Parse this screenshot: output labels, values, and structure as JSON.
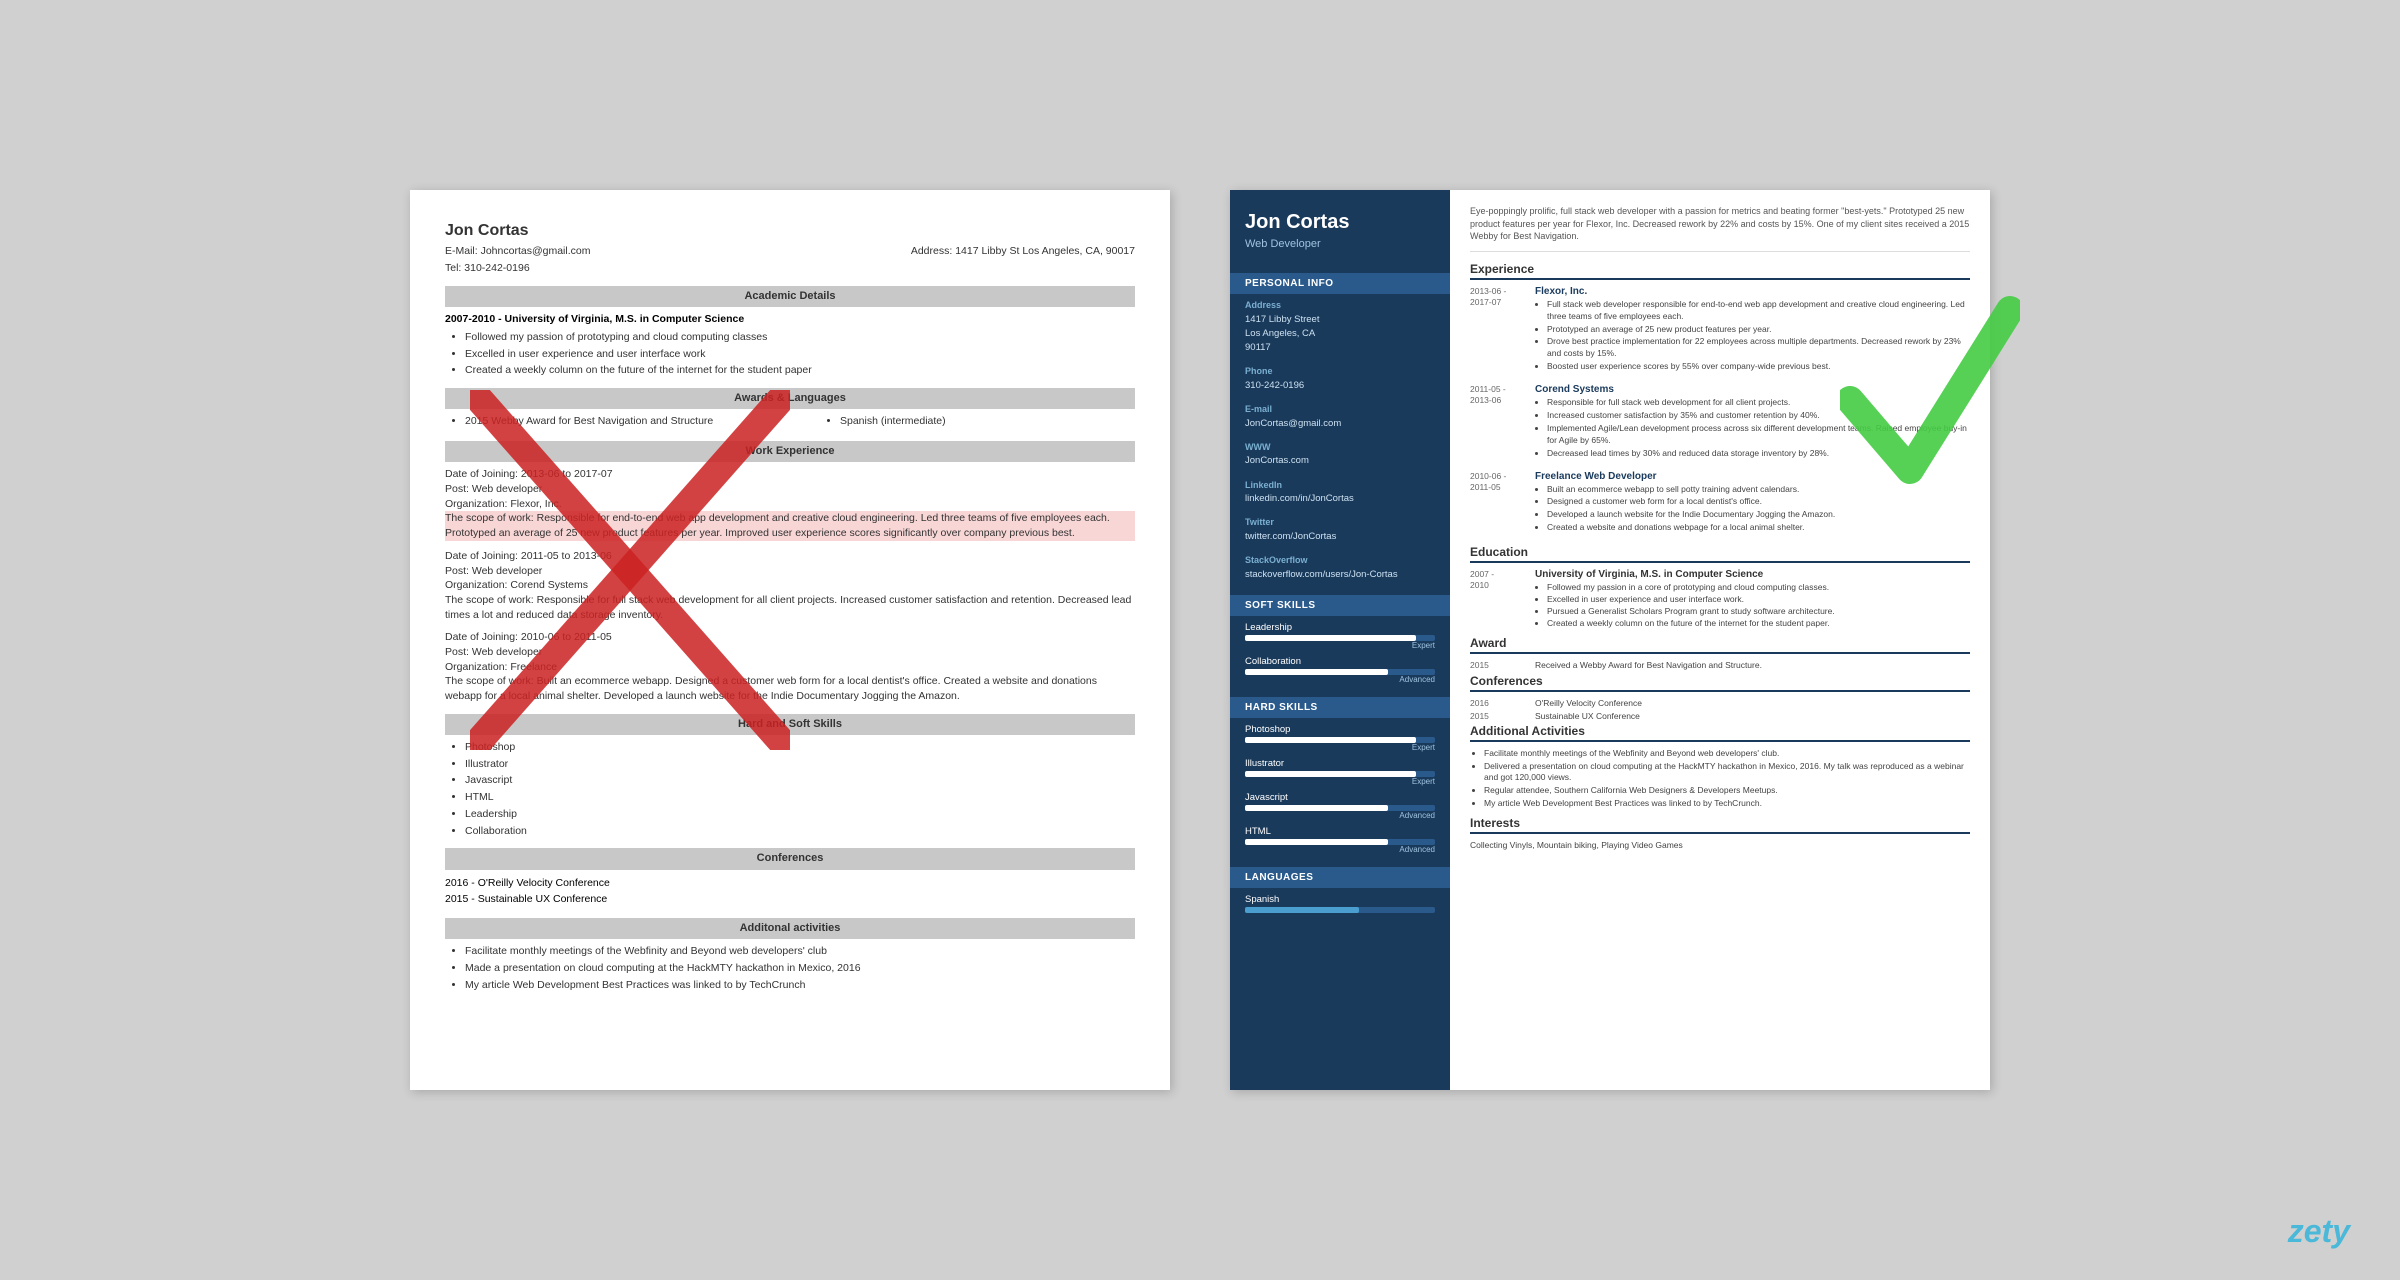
{
  "page": {
    "background": "#d0d0d0"
  },
  "brand": {
    "name": "zety"
  },
  "left_resume": {
    "name": "Jon Cortas",
    "email_label": "E-Mail:",
    "email": "Johncortas@gmail.com",
    "address_label": "Address:",
    "address": "1417 Libby St Los Angeles, CA, 90017",
    "tel_label": "Tel:",
    "tel": "310-242-0196",
    "sections": {
      "academic": "Academic Details",
      "awards": "Awards & Languages",
      "work": "Work Experience",
      "skills": "Hard and Soft Skills",
      "conferences": "Conferences",
      "activities": "Additonal activities"
    },
    "academic": {
      "date": "2007-2010 - University of Virginia, M.S. in Computer Science",
      "bullets": [
        "Followed my passion of prototyping and cloud computing classes",
        "Excelled in user experience and user interface work",
        "Created a weekly column on the future of the internet for the student paper"
      ]
    },
    "awards": {
      "item": "2015 Webby Award for Best Navigation and Structure",
      "language": "Spanish (intermediate)"
    },
    "work": [
      {
        "date": "Date of Joining: 2013-06 to 2017-07",
        "post": "Post: Web developer",
        "org": "Organization: Flexor, Inc.",
        "scope": "The scope of work: Responsible for end-to-end web app development and creative cloud engineering. Led three teams of five employees each. Prototyped an average of 25 new product features per year. Improved user experience scores significantly over company previous best."
      },
      {
        "date": "Date of Joining: 2011-05 to 2013-06",
        "post": "Post: Web developer",
        "org": "Organization: Corend Systems",
        "scope": "The scope of work: Responsible for full stack web development for all client projects. Increased customer satisfaction and retention. Decreased lead times a lot and reduced data storage inventory."
      },
      {
        "date": "Date of Joining: 2010-06 to 2011-05",
        "post": "Post: Web developer",
        "org": "Organization: Freelance",
        "scope": "The scope of work: Built an ecommerce webapp. Designed a customer web form for a local dentist's office. Created a website and donations webapp for a local animal shelter. Developed a launch website for the Indie Documentary Jogging the Amazon."
      }
    ],
    "skills": [
      "Photoshop",
      "Illustrator",
      "Javascript",
      "HTML",
      "Leadership",
      "Collaboration"
    ],
    "conferences": [
      "2016 - O'Reilly Velocity Conference",
      "2015 - Sustainable UX Conference"
    ],
    "activities": [
      "Facilitate monthly meetings of the Webfinity and Beyond web developers' club",
      "Made a presentation on cloud computing at the HackMTY hackathon in Mexico, 2016",
      "My article Web Development Best Practices was linked to by TechCrunch"
    ]
  },
  "right_resume": {
    "name": "Jon Cortas",
    "title": "Web Developer",
    "summary": "Eye-poppingly prolific, full stack web developer with a passion for metrics and beating former \"best-yets.\" Prototyped 25 new product features per year for Flexor, Inc. Decreased rework by 22% and costs by 15%. One of my client sites received a 2015 Webby for Best Navigation.",
    "sidebar": {
      "personal_info_label": "Personal Info",
      "address_label": "Address",
      "address": "1417 Libby Street\nLos Angeles, CA\n90117",
      "phone_label": "Phone",
      "phone": "310-242-0196",
      "email_label": "E-mail",
      "email": "JonCortas@gmail.com",
      "www_label": "WWW",
      "www": "JonCortas.com",
      "linkedin_label": "LinkedIn",
      "linkedin": "linkedin.com/in/JonCortas",
      "twitter_label": "Twitter",
      "twitter": "twitter.com/JonCortas",
      "stackoverflow_label": "StackOverflow",
      "stackoverflow": "stackoverflow.com/users/Jon-Cortas",
      "soft_skills_label": "Soft Skills",
      "soft_skills": [
        {
          "name": "Leadership",
          "level": "Expert",
          "pct": 90
        },
        {
          "name": "Collaboration",
          "level": "Advanced",
          "pct": 75
        }
      ],
      "hard_skills_label": "Hard Skills",
      "hard_skills": [
        {
          "name": "Photoshop",
          "level": "Expert",
          "pct": 90
        },
        {
          "name": "Illustrator",
          "level": "Expert",
          "pct": 90
        },
        {
          "name": "Javascript",
          "level": "Advanced",
          "pct": 75
        },
        {
          "name": "HTML",
          "level": "Advanced",
          "pct": 75
        }
      ],
      "languages_label": "Languages",
      "languages": [
        {
          "name": "Spanish",
          "pct": 60
        }
      ]
    },
    "experience_label": "Experience",
    "experience": [
      {
        "date": "2013-06 -\n2017-07",
        "company": "Flexor, Inc.",
        "bullets": [
          "Full stack web developer responsible for end-to-end web app development and creative cloud engineering. Led three teams of five employees each.",
          "Prototyped an average of 25 new product features per year.",
          "Drove best practice implementation for 22 employees across multiple departments. Decreased rework by 23% and costs by 15%.",
          "Boosted user experience scores by 55% over company-wide previous best."
        ]
      },
      {
        "date": "2011-05 -\n2013-06",
        "company": "Corend Systems",
        "bullets": [
          "Responsible for full stack web development for all client projects.",
          "Increased customer satisfaction by 35% and customer retention by 40%.",
          "Implemented Agile/Lean development process across six different development teams. Raised employee buy-in for Agile by 65%.",
          "Decreased lead times by 30% and reduced data storage inventory by 28%."
        ]
      },
      {
        "date": "2010-06 -\n2011-05",
        "company": "Freelance Web Developer",
        "bullets": [
          "Built an ecommerce webapp to sell potty training advent calendars.",
          "Designed a customer web form for a local dentist's office.",
          "Developed a launch website for the Indie Documentary Jogging the Amazon.",
          "Created a website and donations webpage for a local animal shelter."
        ]
      }
    ],
    "education_label": "Education",
    "education": [
      {
        "date": "2007 -\n2010",
        "title": "University of Virginia, M.S. in Computer Science",
        "bullets": [
          "Followed my passion in a core of prototyping and cloud computing classes.",
          "Excelled in user experience and user interface work.",
          "Pursued a Generalist Scholars Program grant to study software architecture.",
          "Created a weekly column on the future of the internet for the student paper."
        ]
      }
    ],
    "award_label": "Award",
    "awards": [
      {
        "year": "2015",
        "text": "Received a Webby Award for Best Navigation and Structure."
      }
    ],
    "conferences_label": "Conferences",
    "conferences": [
      {
        "year": "2016",
        "text": "O'Reilly Velocity Conference"
      },
      {
        "year": "2015",
        "text": "Sustainable UX Conference"
      }
    ],
    "activities_label": "Additional Activities",
    "activities": [
      "Facilitate monthly meetings of the Webfinity and Beyond web developers' club.",
      "Delivered a presentation on cloud computing at the HackMTY hackathon in Mexico, 2016. My talk was reproduced as a webinar and got 120,000 views.",
      "Regular attendee, Southern California Web Designers & Developers Meetups.",
      "My article Web Development Best Practices was linked to by TechCrunch."
    ],
    "interests_label": "Interests",
    "interests": "Collecting Vinyls, Mountain biking, Playing Video Games"
  }
}
